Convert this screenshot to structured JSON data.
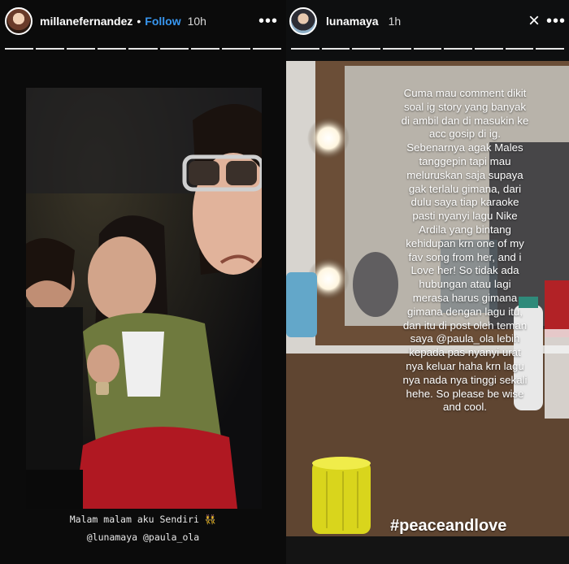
{
  "left_story": {
    "username": "millanefernandez",
    "separator": "•",
    "follow_label": "Follow",
    "time": "10h",
    "more_label": "•••",
    "caption_line1": "Malam malam aku Sendiri",
    "caption_emoji": "👯",
    "caption_mentions": "@lunamaya @paula_ola"
  },
  "right_story": {
    "username": "lunamaya",
    "time": "1h",
    "more_label": "•••",
    "close_label": "×",
    "text_lines": [
      "Cuma mau comment dikit",
      "soal ig story yang banyak",
      "di ambil dan di masukin ke",
      "acc gosip di ig.",
      "Sebenarnya agak Males",
      "tanggepin tapi mau",
      "meluruskan saja supaya",
      "gak terlalu gimana, dari",
      "dulu saya tiap karaoke",
      "pasti nyanyi lagu Nike",
      "Ardila yang bintang",
      "kehidupan krn one of my",
      "fav song from her, and i",
      "Love her! So tidak ada",
      "hubungan atau lagi",
      "merasa harus gimana",
      "gimana dengan lagu itu,",
      "dan itu di post oleh teman",
      "saya @paula_ola lebih",
      "kepada pas nyanyi urat",
      "nya keluar haha krn lagu",
      "nya nada nya tinggi sekali",
      "hehe. So please be wise",
      "and cool."
    ],
    "hashtag": "#peaceandlove"
  }
}
